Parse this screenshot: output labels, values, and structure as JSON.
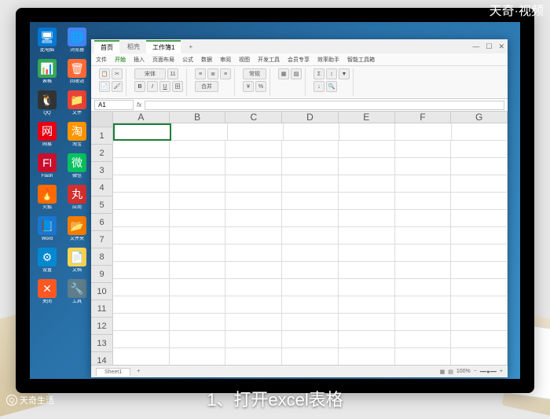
{
  "watermarks": {
    "topRight": "天奇·视频",
    "bottomLeft": "天奇生活"
  },
  "caption": "1、打开excel表格",
  "desktopIcons": [
    {
      "bg": "#0078d4",
      "sym": "🖥",
      "txt": "此电脑"
    },
    {
      "bg": "#4285f4",
      "sym": "🌐",
      "txt": "浏览器"
    },
    {
      "bg": "#34a853",
      "sym": "📊",
      "txt": "表格"
    },
    {
      "bg": "#ff6b35",
      "sym": "🗑",
      "txt": "回收站"
    },
    {
      "bg": "#333",
      "sym": "🐧",
      "txt": "QQ"
    },
    {
      "bg": "#ea4335",
      "sym": "📁",
      "txt": "文件"
    },
    {
      "bg": "#e60012",
      "sym": "网",
      "txt": "网易"
    },
    {
      "bg": "#ff9500",
      "sym": "淘",
      "txt": "淘宝"
    },
    {
      "bg": "#c8102e",
      "sym": "Fl",
      "txt": "Flash"
    },
    {
      "bg": "#07c160",
      "sym": "微",
      "txt": "微信"
    },
    {
      "bg": "#ff6a00",
      "sym": "🔥",
      "txt": "火狐"
    },
    {
      "bg": "#d32f2f",
      "sym": "丸",
      "txt": "应用"
    },
    {
      "bg": "#1976d2",
      "sym": "📘",
      "txt": "Word"
    },
    {
      "bg": "#f57c00",
      "sym": "📂",
      "txt": "文件夹"
    },
    {
      "bg": "#0288d1",
      "sym": "⚙",
      "txt": "设置"
    },
    {
      "bg": "#ffd54f",
      "sym": "📄",
      "txt": "文档"
    },
    {
      "bg": "#ff5722",
      "sym": "✕",
      "txt": "关闭"
    },
    {
      "bg": "#607d8b",
      "sym": "🔧",
      "txt": "工具"
    }
  ],
  "tabs": {
    "home": "首页",
    "doc": "稻壳",
    "sheet": "工作簿1"
  },
  "menus": [
    "文件",
    "开始",
    "插入",
    "页面布局",
    "公式",
    "数据",
    "审阅",
    "视图",
    "开发工具",
    "会员专享",
    "效率助手",
    "智能工具箱"
  ],
  "activeMenu": "开始",
  "nameBox": "A1",
  "columns": [
    "A",
    "B",
    "C",
    "D",
    "E",
    "F",
    "G"
  ],
  "rowCount": 14,
  "selectedCell": {
    "row": 1,
    "col": "A"
  },
  "sheetTab": "Sheet1",
  "zoom": "100%",
  "winCtrl": {
    "min": "—",
    "max": "☐",
    "close": "✕"
  }
}
